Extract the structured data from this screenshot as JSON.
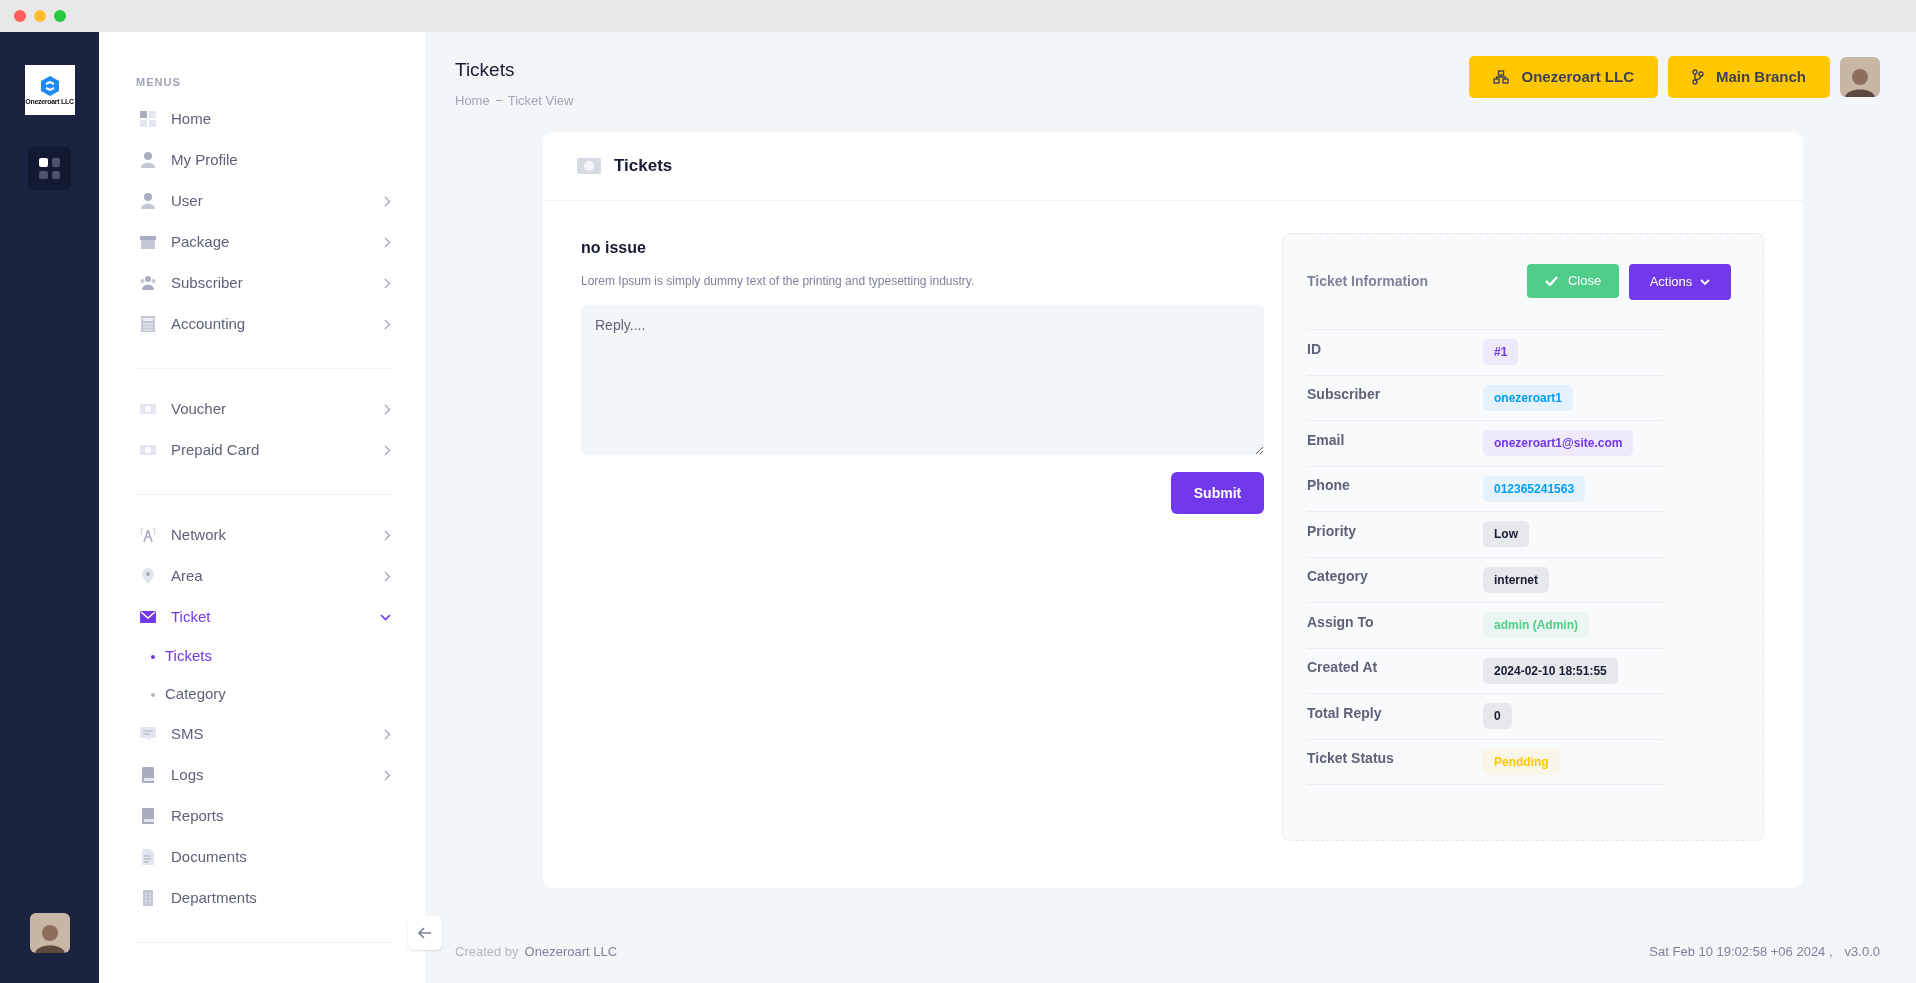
{
  "logo": {
    "text": "Onezeroart LLC"
  },
  "sidebar": {
    "heading": "MENUS",
    "sections": [
      {
        "items": [
          {
            "label": "Home",
            "expandable": false,
            "selected": false
          },
          {
            "label": "My Profile",
            "expandable": false,
            "selected": false
          },
          {
            "label": "User",
            "expandable": true,
            "expanded": false,
            "selected": false
          },
          {
            "label": "Package",
            "expandable": true,
            "expanded": false,
            "selected": false
          },
          {
            "label": "Subscriber",
            "expandable": true,
            "expanded": false,
            "selected": false
          },
          {
            "label": "Accounting",
            "expandable": true,
            "expanded": false,
            "selected": false
          }
        ]
      },
      {
        "items": [
          {
            "label": "Voucher",
            "expandable": true,
            "expanded": false,
            "selected": false
          },
          {
            "label": "Prepaid Card",
            "expandable": true,
            "expanded": false,
            "selected": false
          }
        ]
      },
      {
        "items": [
          {
            "label": "Network",
            "expandable": true,
            "expanded": false,
            "selected": false
          },
          {
            "label": "Area",
            "expandable": true,
            "expanded": false,
            "selected": false
          },
          {
            "label": "Ticket",
            "expandable": true,
            "expanded": true,
            "selected": true,
            "children": [
              {
                "label": "Tickets",
                "selected": true
              },
              {
                "label": "Category",
                "selected": false
              }
            ]
          },
          {
            "label": "SMS",
            "expandable": true,
            "expanded": false,
            "selected": false
          },
          {
            "label": "Logs",
            "expandable": true,
            "expanded": false,
            "selected": false
          },
          {
            "label": "Reports",
            "expandable": false,
            "selected": false
          },
          {
            "label": "Documents",
            "expandable": false,
            "selected": false
          },
          {
            "label": "Departments",
            "expandable": false,
            "selected": false
          }
        ]
      }
    ]
  },
  "header": {
    "title": "Tickets",
    "breadcrumb": [
      "Home",
      "Ticket View"
    ],
    "buttons": [
      {
        "kind": "org",
        "label": "Onezeroart LLC"
      },
      {
        "kind": "branch",
        "label": "Main Branch"
      }
    ]
  },
  "card": {
    "title": "Tickets",
    "issue_title": "no issue",
    "issue_text": "Lorem Ipsum is simply dummy text of the printing and typesetting industry.",
    "reply": {
      "placeholder": "Reply...."
    },
    "submit": "Submit",
    "info": {
      "title": "Ticket Information",
      "close_button": "Close",
      "actions_button": "Actions",
      "rows": [
        {
          "label": "ID",
          "value": "#1",
          "color": "#7239ea"
        },
        {
          "label": "Subscriber",
          "value": "onezeroart1",
          "color": "#009ef7"
        },
        {
          "label": "Email",
          "value": "onezeroart1@site.com",
          "color": "#7239ea"
        },
        {
          "label": "Phone",
          "value": "012365241563",
          "color": "#009ef7"
        },
        {
          "label": "Priority",
          "value": "Low",
          "color": "#181c32"
        },
        {
          "label": "Category",
          "value": "internet",
          "color": "#181c32"
        },
        {
          "label": "Assign To",
          "value": "admin (Admin)",
          "color": "#50cd89"
        },
        {
          "label": "Created At",
          "value": "2024-02-10 18:51:55",
          "color": "#181c32"
        },
        {
          "label": "Total Reply",
          "value": "0",
          "color": "#181c32"
        },
        {
          "label": "Ticket Status",
          "value": "Pendding",
          "color": "#ffc700"
        }
      ]
    }
  },
  "footer": {
    "created_by": "Created by",
    "company": "Onezeroart LLC",
    "timestamp": "Sat Feb 10 19:02:58 +06 2024 ,",
    "version": "v3.0.0"
  }
}
